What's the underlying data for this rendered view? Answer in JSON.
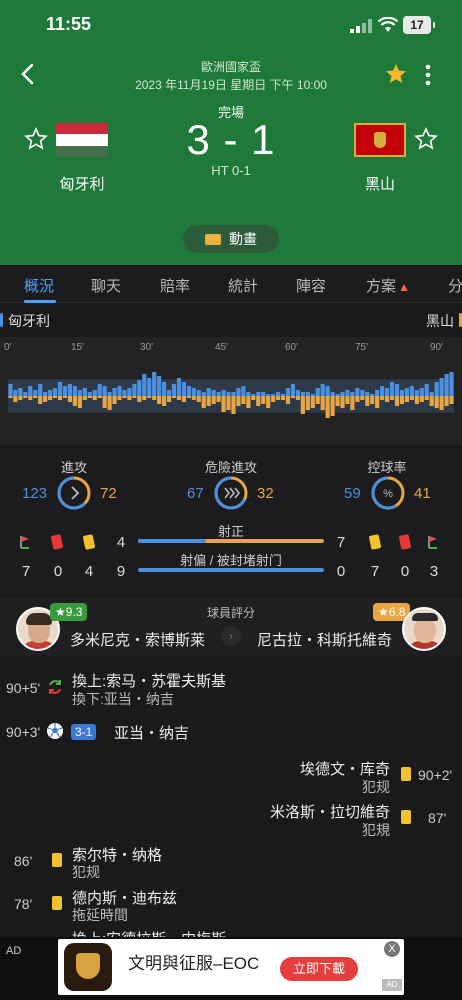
{
  "status_bar": {
    "time": "11:55",
    "battery": "17"
  },
  "header": {
    "competition": "歐洲國家盃",
    "datetime": "2023 年11月19日 星期日 下午 10:00",
    "status": "完場",
    "score": "3 - 1",
    "halftime": "HT 0-1",
    "home_team": "匈牙利",
    "away_team": "黑山",
    "animation_label": "動畫"
  },
  "tabs": [
    "概況",
    "聊天",
    "賠率",
    "統計",
    "陣容",
    "方案",
    "分"
  ],
  "momentum": {
    "home": "匈牙利",
    "away": "黑山",
    "minute_marks": [
      "0'",
      "15'",
      "30'",
      "45'",
      "60'",
      "75'",
      "90'"
    ],
    "home_bars": [
      0.3,
      0.15,
      0.2,
      0.1,
      0.25,
      0.15,
      0.3,
      0.1,
      0.15,
      0.2,
      0.35,
      0.25,
      0.3,
      0.25,
      0.15,
      0.2,
      0.1,
      0.15,
      0.3,
      0.25,
      0.1,
      0.2,
      0.25,
      0.15,
      0.2,
      0.3,
      0.4,
      0.55,
      0.45,
      0.6,
      0.5,
      0.35,
      0.15,
      0.3,
      0.45,
      0.35,
      0.25,
      0.2,
      0.15,
      0.1,
      0.2,
      0.15,
      0.1,
      0.15,
      0.1,
      0.1,
      0.2,
      0.25,
      0.1,
      0.05,
      0.1,
      0.1,
      0.05,
      0.05,
      0.1,
      0.05,
      0.2,
      0.3,
      0.15,
      0.1,
      0.1,
      0.05,
      0.2,
      0.3,
      0.25,
      0.1,
      0.05,
      0.1,
      0.15,
      0.1,
      0.2,
      0.15,
      0.1,
      0.05,
      0.15,
      0.25,
      0.2,
      0.35,
      0.3,
      0.15,
      0.2,
      0.25,
      0.15,
      0.2,
      0.3,
      0.1,
      0.35,
      0.45,
      0.55,
      0.6
    ],
    "away_bars": [
      0.05,
      0.15,
      0.1,
      0.05,
      0.1,
      0.05,
      0.2,
      0.15,
      0.1,
      0.05,
      0.1,
      0.05,
      0.15,
      0.25,
      0.3,
      0.1,
      0.05,
      0.1,
      0.05,
      0.3,
      0.35,
      0.2,
      0.1,
      0.05,
      0.1,
      0.05,
      0.15,
      0.1,
      0.05,
      0.1,
      0.2,
      0.25,
      0.15,
      0.05,
      0.1,
      0.15,
      0.05,
      0.1,
      0.15,
      0.3,
      0.25,
      0.2,
      0.15,
      0.4,
      0.35,
      0.45,
      0.25,
      0.2,
      0.3,
      0.1,
      0.25,
      0.2,
      0.3,
      0.15,
      0.1,
      0.1,
      0.2,
      0.05,
      0.1,
      0.45,
      0.35,
      0.3,
      0.2,
      0.35,
      0.55,
      0.5,
      0.25,
      0.3,
      0.2,
      0.35,
      0.15,
      0.1,
      0.25,
      0.2,
      0.3,
      0.1,
      0.15,
      0.1,
      0.25,
      0.2,
      0.15,
      0.1,
      0.2,
      0.15,
      0.1,
      0.25,
      0.3,
      0.35,
      0.25,
      0.2
    ]
  },
  "stats": {
    "attack": {
      "label": "進攻",
      "home": "123",
      "away": "72",
      "home_frac": 0.63
    },
    "danger": {
      "label": "危險進攻",
      "home": "67",
      "away": "32",
      "home_frac": 0.68
    },
    "possession": {
      "label": "控球率",
      "home": "59",
      "away": "41",
      "home_frac": 0.59
    },
    "on_target": {
      "label": "射正",
      "home": "4",
      "away": "7"
    },
    "off_target": {
      "label": "射偏 / 被封堵射门",
      "home": "9",
      "away": "0"
    },
    "home_counts": {
      "corners": "7",
      "red": "0",
      "yellow": "4"
    },
    "away_counts": {
      "yellow": "7",
      "red": "0",
      "corners": "3"
    }
  },
  "ratings": {
    "title": "球員評分",
    "home_player": "多米尼克・索博斯莱",
    "home_rating": "9.3",
    "away_player": "尼古拉・科斯托維奇",
    "away_rating": "6.8"
  },
  "events": {
    "e1": {
      "minute": "90+5'",
      "line1": "換上:索马・苏霍夫斯基",
      "line2": "換下:亚当・纳吉"
    },
    "e2": {
      "minute": "90+3'",
      "score": "3-1",
      "player": "亚当・纳吉"
    },
    "e3": {
      "minute": "90+2'",
      "player": "埃德文・库奇",
      "reason": "犯规"
    },
    "e4": {
      "minute": "87'",
      "player": "米洛斯・拉切維奇",
      "reason": "犯規"
    },
    "e5": {
      "minute": "86'",
      "player": "索尔特・纳格",
      "reason": "犯规"
    },
    "e6": {
      "minute": "78'",
      "player": "德内斯・迪布兹",
      "reason": "拖延時間"
    },
    "e7": {
      "line1": "換上:安德拉斯・内梅斯"
    }
  },
  "ad": {
    "label": "AD",
    "title": "文明與征服–EOC",
    "button": "立即下載",
    "close": "X",
    "corner": "AD"
  }
}
